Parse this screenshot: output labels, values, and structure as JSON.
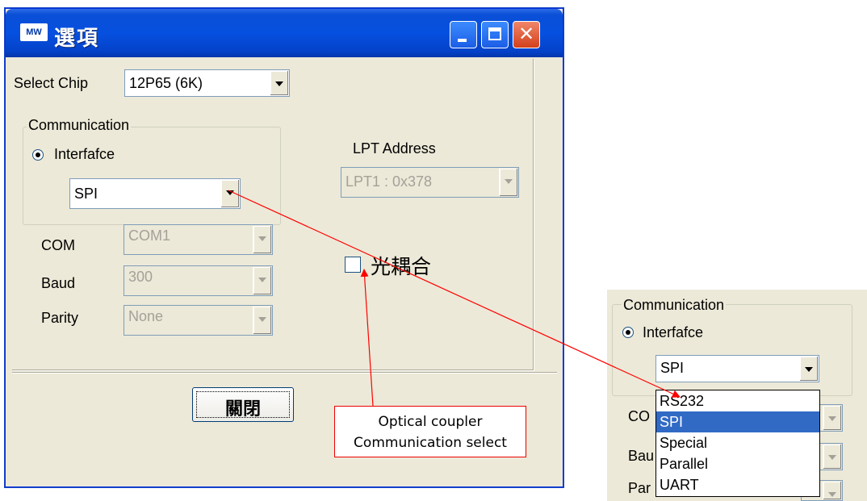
{
  "window": {
    "title": "選項",
    "logo_text": "MW"
  },
  "select_chip": {
    "label": "Select Chip",
    "value": "12P65 (6K)"
  },
  "communication": {
    "group_label": "Communication",
    "radio_label": "Interfafce",
    "interface_value": "SPI"
  },
  "lpt": {
    "label": "LPT Address",
    "value": "LPT1 : 0x378"
  },
  "com": {
    "label": "COM",
    "value": "COM1"
  },
  "baud": {
    "label": "Baud",
    "value": "300"
  },
  "parity": {
    "label": "Parity",
    "value": "None"
  },
  "optical": {
    "label": "光耦合"
  },
  "close_button": {
    "label": "關閉"
  },
  "callout": {
    "line1": "Optical coupler",
    "line2": "Communication select"
  },
  "inset": {
    "group_label": "Communication",
    "radio_label": "Interfafce",
    "interface_value": "SPI",
    "cut_labels": [
      "CO",
      "Bau",
      "Par"
    ],
    "options": [
      "RS232",
      "SPI",
      "Special",
      "Parallel",
      "UART"
    ],
    "selected_option": "SPI"
  },
  "colors": {
    "titlebar": "#0650e0",
    "dialog_bg": "#ece9d8",
    "selection": "#316ac5",
    "annotation": "#ff0000"
  }
}
